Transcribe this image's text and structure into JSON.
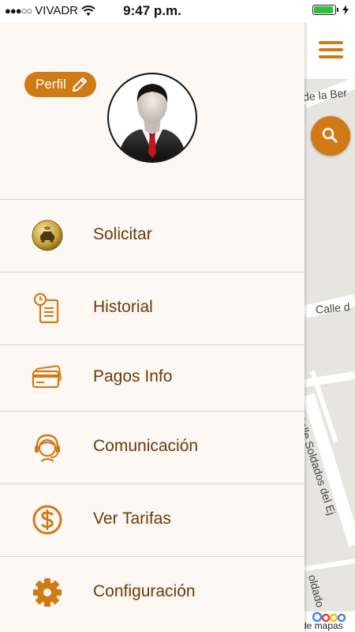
{
  "status_bar": {
    "carrier": "VIVADR",
    "time": "9:47 p.m.",
    "signal_dots": "●●●○○"
  },
  "drawer": {
    "profile_label": "Perfil",
    "menu": [
      {
        "label": "Solicitar",
        "icon": "taxi-coin-icon"
      },
      {
        "label": "Historial",
        "icon": "history-document-icon"
      },
      {
        "label": "Pagos Info",
        "icon": "credit-cards-icon"
      },
      {
        "label": "Comunicación",
        "icon": "headset-operator-icon"
      },
      {
        "label": "Ver Tarifas",
        "icon": "dollar-circle-icon"
      },
      {
        "label": "Configuración",
        "icon": "gear-icon"
      }
    ]
  },
  "map": {
    "streets": [
      "de la Ber",
      "Calle d",
      "Calle Soldados del Ej",
      "oldado"
    ],
    "attribution": "de mapas"
  },
  "colors": {
    "accent": "#d07a15",
    "menu_text": "#6b3a0a",
    "drawer_bg": "#fdf8f3"
  }
}
